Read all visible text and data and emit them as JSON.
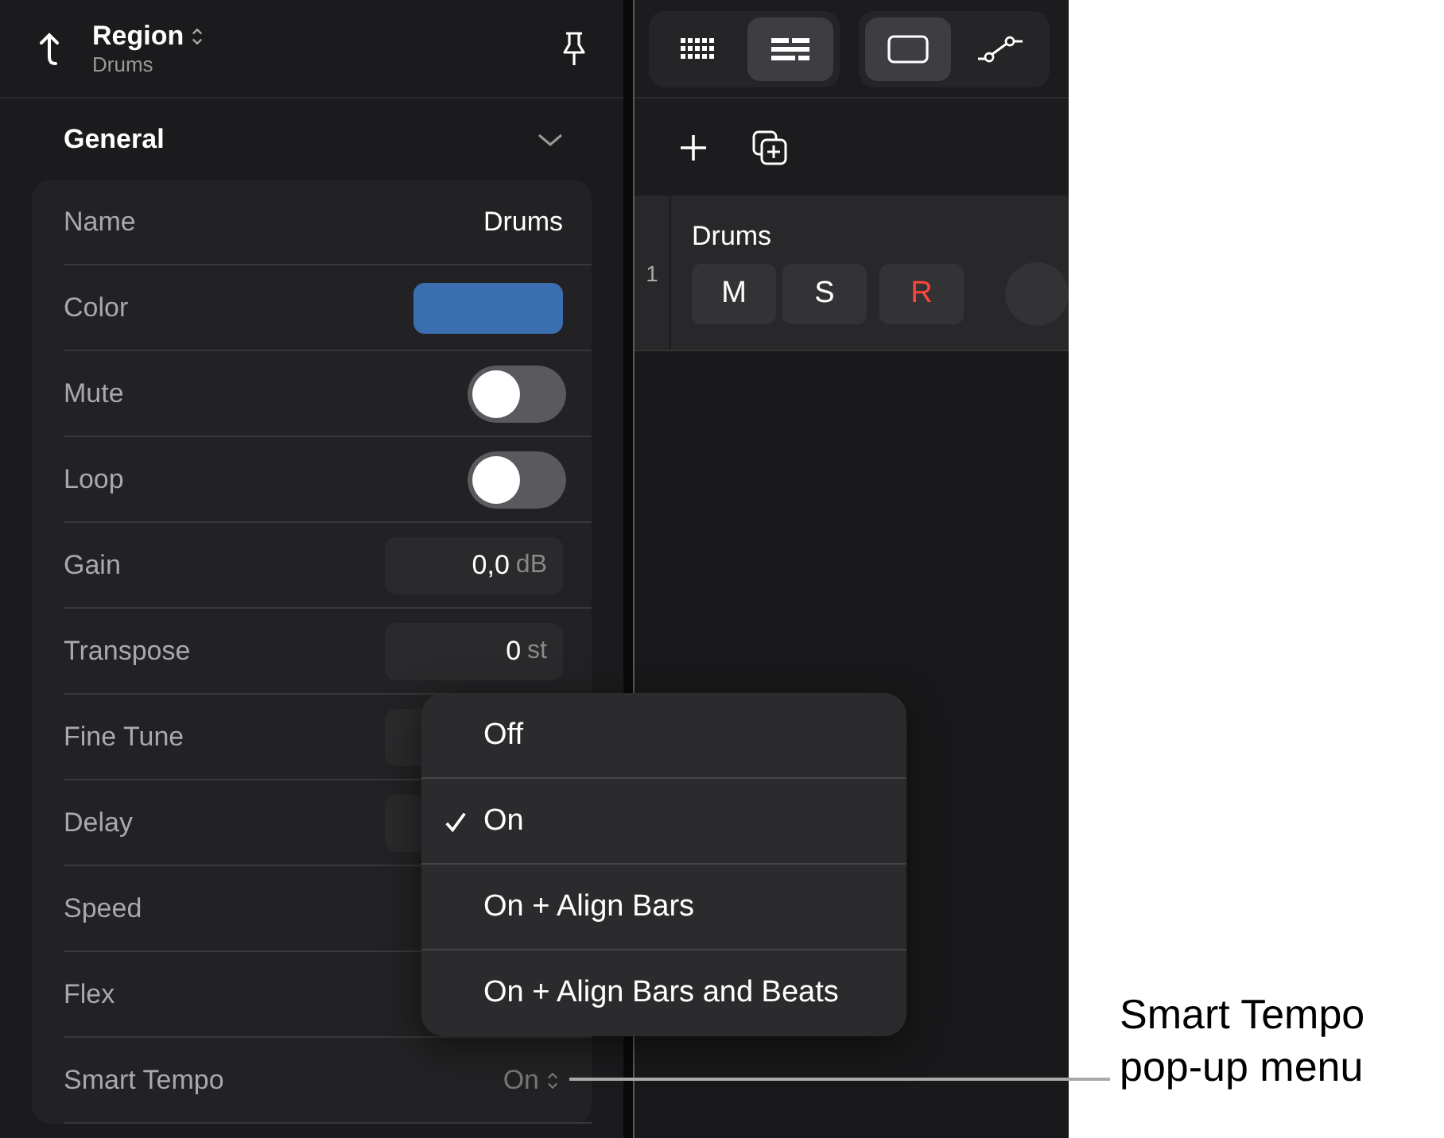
{
  "header": {
    "title": "Region",
    "subtitle": "Drums"
  },
  "section": {
    "title": "General"
  },
  "rows": [
    {
      "label": "Name",
      "kind": "text",
      "value": "Drums"
    },
    {
      "label": "Color",
      "kind": "color",
      "color": "#3a6eb0"
    },
    {
      "label": "Mute",
      "kind": "toggle",
      "on": false
    },
    {
      "label": "Loop",
      "kind": "toggle",
      "on": false
    },
    {
      "label": "Gain",
      "kind": "number",
      "value": "0,0",
      "unit": "dB"
    },
    {
      "label": "Transpose",
      "kind": "number",
      "value": "0",
      "unit": "st"
    },
    {
      "label": "Fine Tune",
      "kind": "number"
    },
    {
      "label": "Delay",
      "kind": "number"
    },
    {
      "label": "Speed",
      "kind": "plain"
    },
    {
      "label": "Flex",
      "kind": "plain"
    },
    {
      "label": "Smart Tempo",
      "kind": "popup",
      "value": "On"
    }
  ],
  "toolbar": {
    "groups": [
      {
        "buttons": [
          {
            "kind": "grid",
            "selected": false
          },
          {
            "kind": "list",
            "selected": true
          }
        ]
      },
      {
        "buttons": [
          {
            "kind": "region",
            "selected": true
          },
          {
            "kind": "automation",
            "selected": false
          }
        ]
      }
    ]
  },
  "track": {
    "number": "1",
    "name": "Drums",
    "buttons": [
      {
        "label": "M",
        "kind": "mute"
      },
      {
        "label": "S",
        "kind": "solo"
      },
      {
        "label": "R",
        "kind": "record"
      }
    ]
  },
  "menu": {
    "items": [
      {
        "label": "Off",
        "selected": false
      },
      {
        "label": "On",
        "selected": true
      },
      {
        "label": "On + Align Bars",
        "selected": false
      },
      {
        "label": "On + Align Bars and Beats",
        "selected": false
      }
    ]
  },
  "callout": {
    "text": "Smart Tempo pop-up menu"
  }
}
